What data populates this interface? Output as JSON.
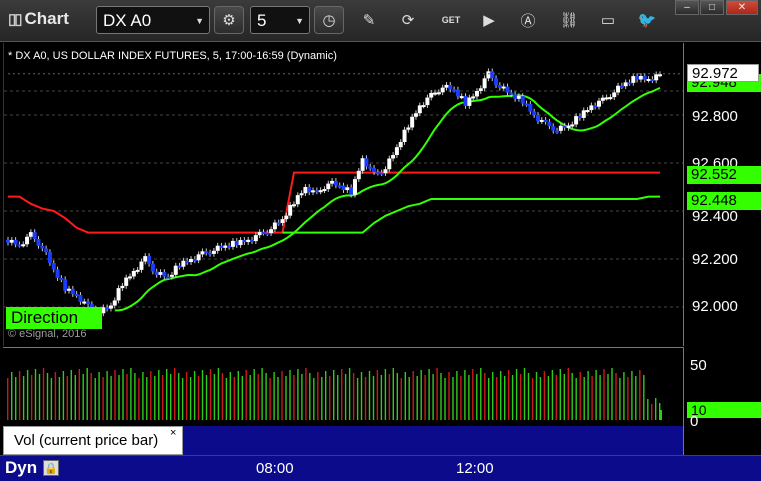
{
  "toolbar": {
    "app_title": "Chart",
    "symbol": "DX A0",
    "interval": "5",
    "icons": [
      "gear-icon",
      "clock-icon",
      "pencil-icon",
      "refresh-icon",
      "get-quote-icon",
      "play-icon",
      "alert-icon",
      "link-icon",
      "chat-icon",
      "twitter-icon"
    ],
    "get_label": "GET",
    "window_buttons": [
      "minimize",
      "maximize",
      "close"
    ]
  },
  "chart": {
    "header": "* DX A0, US DOLLAR INDEX FUTURES, 5, 17:00-16:59 (Dynamic)",
    "watermark": "© eSignal, 2016",
    "direction_label": "Direction",
    "price_ticks": [
      "92.800",
      "92.600",
      "92.400",
      "92.200",
      "92.000"
    ],
    "price_tag_current": "92.972",
    "price_tag_upper_green": "92.948",
    "price_tag_mid_green": "92.552",
    "price_tag_low_green": "92.448",
    "colors": {
      "up_candle": "#ffffff",
      "down_candle": "#1a3cff",
      "red_line": "#ff1a1a",
      "green_line": "#33ff00",
      "accent_green": "#33ff00",
      "axis_bg": "#0b0b8c"
    }
  },
  "volume": {
    "ticks": [
      "50",
      "0"
    ],
    "current_tag": "10",
    "caption": "Vol (current price bar)",
    "caption_close": "×"
  },
  "time_axis": {
    "ticks": [
      "08:00",
      "12:00"
    ],
    "mode_label": "Dyn",
    "mode_icon": "lock-icon"
  },
  "chart_data": {
    "type": "candlestick",
    "title": "* DX A0, US DOLLAR INDEX FUTURES, 5, 17:00-16:59 (Dynamic)",
    "ylim": [
      91.95,
      93.05
    ],
    "y_ticks": [
      92.0,
      92.2,
      92.4,
      92.6,
      92.8
    ],
    "x_ticks": [
      "08:00",
      "12:00"
    ],
    "close_path": [
      92.28,
      92.26,
      92.3,
      92.25,
      92.15,
      92.08,
      92.05,
      92.0,
      91.98,
      92.0,
      92.1,
      92.15,
      92.2,
      92.14,
      92.12,
      92.18,
      92.2,
      92.22,
      92.24,
      92.25,
      92.27,
      92.28,
      92.3,
      92.33,
      92.36,
      92.44,
      92.5,
      92.47,
      92.52,
      92.5,
      92.48,
      92.62,
      92.55,
      92.58,
      92.66,
      92.76,
      92.84,
      92.88,
      92.92,
      92.9,
      92.85,
      92.9,
      92.97,
      92.92,
      92.88,
      92.86,
      92.8,
      92.76,
      92.74,
      92.75,
      92.8,
      92.84,
      92.86,
      92.9,
      92.93,
      92.96,
      92.95,
      92.97
    ],
    "series": [
      {
        "name": "red_ma",
        "values": [
          92.46,
          92.46,
          92.43,
          92.41,
          92.4,
          92.37,
          92.33,
          92.31,
          92.31,
          92.31,
          92.31,
          92.31,
          92.31,
          92.31,
          92.31,
          92.31,
          92.31,
          92.31,
          92.31,
          92.31,
          92.31,
          92.31,
          92.31,
          92.31,
          92.31,
          92.56,
          92.56,
          92.56,
          92.56,
          92.56,
          92.56,
          92.56,
          92.56,
          92.56,
          92.56,
          92.56,
          92.56,
          92.56,
          92.56,
          92.56,
          92.56,
          92.56,
          92.56,
          92.56,
          92.56,
          92.56,
          92.56,
          92.56,
          92.56,
          92.56,
          92.56,
          92.56,
          92.56,
          92.56,
          92.56,
          92.56,
          92.56,
          92.56
        ]
      },
      {
        "name": "green_floor",
        "values": [
          null,
          null,
          null,
          null,
          null,
          null,
          null,
          null,
          null,
          null,
          null,
          null,
          null,
          null,
          null,
          null,
          null,
          null,
          null,
          null,
          null,
          null,
          null,
          null,
          92.31,
          92.31,
          92.31,
          92.31,
          92.31,
          92.31,
          92.31,
          92.31,
          92.35,
          92.38,
          92.4,
          92.42,
          92.43,
          92.45,
          92.45,
          92.45,
          92.45,
          92.45,
          92.45,
          92.45,
          92.45,
          92.45,
          92.45,
          92.45,
          92.45,
          92.45,
          92.45,
          92.45,
          92.45,
          92.45,
          92.45,
          92.45,
          92.46,
          92.46
        ]
      }
    ],
    "volume": {
      "ylim": [
        0,
        60
      ],
      "last": 10
    }
  }
}
